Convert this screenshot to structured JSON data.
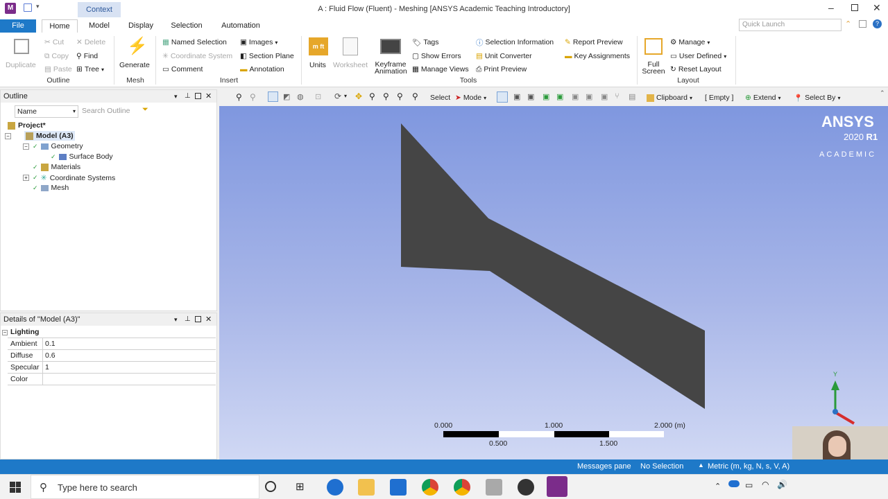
{
  "window": {
    "context_tab": "Context",
    "title": "A : Fluid Flow (Fluent) - Meshing [ANSYS Academic Teaching Introductory]",
    "quick_launch_placeholder": "Quick Launch"
  },
  "tabs": [
    "File",
    "Home",
    "Model",
    "Display",
    "Selection",
    "Automation"
  ],
  "ribbon": {
    "outline_group": {
      "label": "Outline",
      "duplicate": "Duplicate",
      "cut": "Cut",
      "copy": "Copy",
      "paste": "Paste",
      "delete": "Delete",
      "find": "Find",
      "tree": "Tree"
    },
    "mesh_group": {
      "label": "Mesh",
      "generate": "Generate"
    },
    "insert_group": {
      "label": "Insert",
      "named_selection": "Named Selection",
      "coordinate_system": "Coordinate System",
      "comment": "Comment",
      "images": "Images",
      "section_plane": "Section Plane",
      "annotation": "Annotation"
    },
    "tools_group": {
      "label": "Tools",
      "units": "Units",
      "worksheet": "Worksheet",
      "keyframe": "Keyframe",
      "animation": "Animation",
      "tags": "Tags",
      "show_errors": "Show Errors",
      "manage_views": "Manage Views",
      "selection_information": "Selection Information",
      "unit_converter": "Unit Converter",
      "print_preview": "Print Preview",
      "report_preview": "Report Preview",
      "key_assignments": "Key Assignments"
    },
    "layout_group": {
      "label": "Layout",
      "full": "Full",
      "screen": "Screen",
      "manage": "Manage",
      "user_defined": "User Defined",
      "reset_layout": "Reset Layout"
    }
  },
  "outline": {
    "title": "Outline",
    "filter_name": "Name",
    "search_placeholder": "Search Outline",
    "tree": {
      "project": "Project*",
      "model": "Model (A3)",
      "geometry": "Geometry",
      "surface_body": "Surface Body",
      "materials": "Materials",
      "coordinate_systems": "Coordinate Systems",
      "mesh": "Mesh"
    }
  },
  "details": {
    "title": "Details of \"Model (A3)\"",
    "section": "Lighting",
    "rows": [
      {
        "label": "Ambient",
        "value": "0.1"
      },
      {
        "label": "Diffuse",
        "value": "0.6"
      },
      {
        "label": "Specular",
        "value": "1"
      },
      {
        "label": "Color",
        "value": ""
      }
    ]
  },
  "graphics_toolbar": {
    "select": "Select",
    "mode": "Mode",
    "clipboard": "Clipboard",
    "clipboard_state": "[ Empty ]",
    "extend": "Extend",
    "select_by": "Select By"
  },
  "viewport": {
    "brand": "ANSYS",
    "version_prefix": "2020",
    "version_suffix": "R1",
    "edition": "ACADEMIC",
    "scale_top": [
      "0.000",
      "1.000",
      "2.000 (m)"
    ],
    "scale_bottom": [
      "0.500",
      "1.500"
    ],
    "axis_label": "Y"
  },
  "status": {
    "messages_pane": "Messages pane",
    "selection": "No Selection",
    "units": "Metric (m, kg, N, s, V, A)"
  },
  "taskbar": {
    "search_placeholder": "Type here to search"
  },
  "colors": {
    "accent": "#1e79c8",
    "geometry": "#454545"
  }
}
